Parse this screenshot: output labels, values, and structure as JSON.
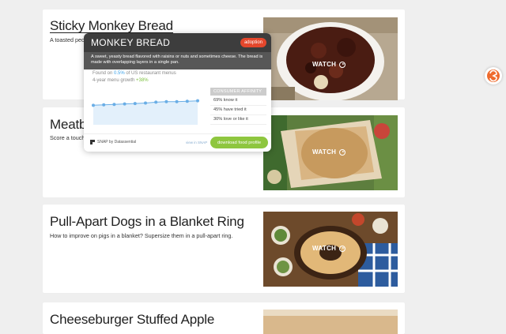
{
  "cards": [
    {
      "title": "Sticky Monkey Bread",
      "desc": "A toasted pecan",
      "watch": "WATCH"
    },
    {
      "title": "Meatba",
      "desc": "Score a touchd",
      "watch": "WATCH"
    },
    {
      "title": "Pull-Apart Dogs in a Blanket Ring",
      "desc": "How to improve on pigs in a blanket? Supersize them in a pull-apart ring.",
      "watch": "WATCH"
    },
    {
      "title": "Cheeseburger Stuffed Apple"
    }
  ],
  "popup": {
    "title": "MONKEY BREAD",
    "badge": "adoption",
    "description": "A sweet, yeasty bread flavored with raisins or nuts and sometimes cheese. The bread is made with overlapping layers in a single pan.",
    "found_prefix": "Found on",
    "found_value": "0.5%",
    "found_suffix": "of US restaurant menus",
    "growth_prefix": "4-year menu growth",
    "growth_value": "+38%",
    "affinity_title": "CONSUMER AFFINITY",
    "affinity": [
      "69% know it",
      "45% have tried it",
      "30% love or like it"
    ],
    "footer_brand": "SNAP by Datassential",
    "view_link": "view in SNAP",
    "download_label": "download food profile"
  },
  "chart_data": {
    "type": "area",
    "values": [
      0.4,
      0.41,
      0.42,
      0.43,
      0.44,
      0.45,
      0.47,
      0.48,
      0.48,
      0.49,
      0.5
    ],
    "ylim": [
      0.0,
      0.6
    ],
    "grid": false
  },
  "colors": {
    "badge": "#e4472c",
    "download": "#8ec63f",
    "highlight_blue": "#3aa0e8",
    "highlight_green": "#7cc13f",
    "line": "#6aaee6"
  },
  "icons": [
    "play-icon",
    "snap-logo-icon",
    "extension-icon"
  ]
}
